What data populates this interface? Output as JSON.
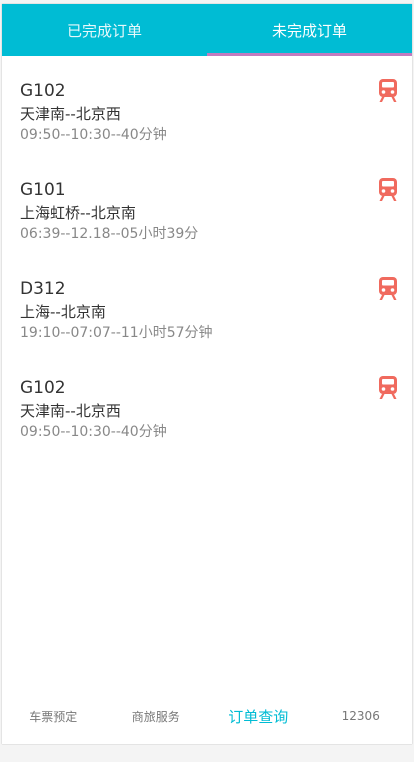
{
  "tabs": [
    {
      "label": "已完成订单"
    },
    {
      "label": "未完成订单"
    }
  ],
  "active_tab": 1,
  "orders": [
    {
      "train": "G102",
      "route": "天津南--北京西",
      "time": "09:50--10:30--40分钟"
    },
    {
      "train": "G101",
      "route": "上海虹桥--北京南",
      "time": "06:39--12.18--05小时39分"
    },
    {
      "train": "D312",
      "route": "上海--北京南",
      "time": "19:10--07:07--11小时57分钟"
    },
    {
      "train": "G102",
      "route": "天津南--北京西",
      "time": "09:50--10:30--40分钟"
    }
  ],
  "bottom_nav": [
    {
      "label": "车票预定"
    },
    {
      "label": "商旅服务"
    },
    {
      "label": "订单查询"
    },
    {
      "label": "12306"
    }
  ],
  "active_nav": 2,
  "colors": {
    "header": "#00bcd4",
    "tab_indicator": "#c27bbf",
    "train_icon": "#f06a5e",
    "active_nav": "#00bcd4"
  },
  "icons": {
    "order": "train-icon"
  }
}
